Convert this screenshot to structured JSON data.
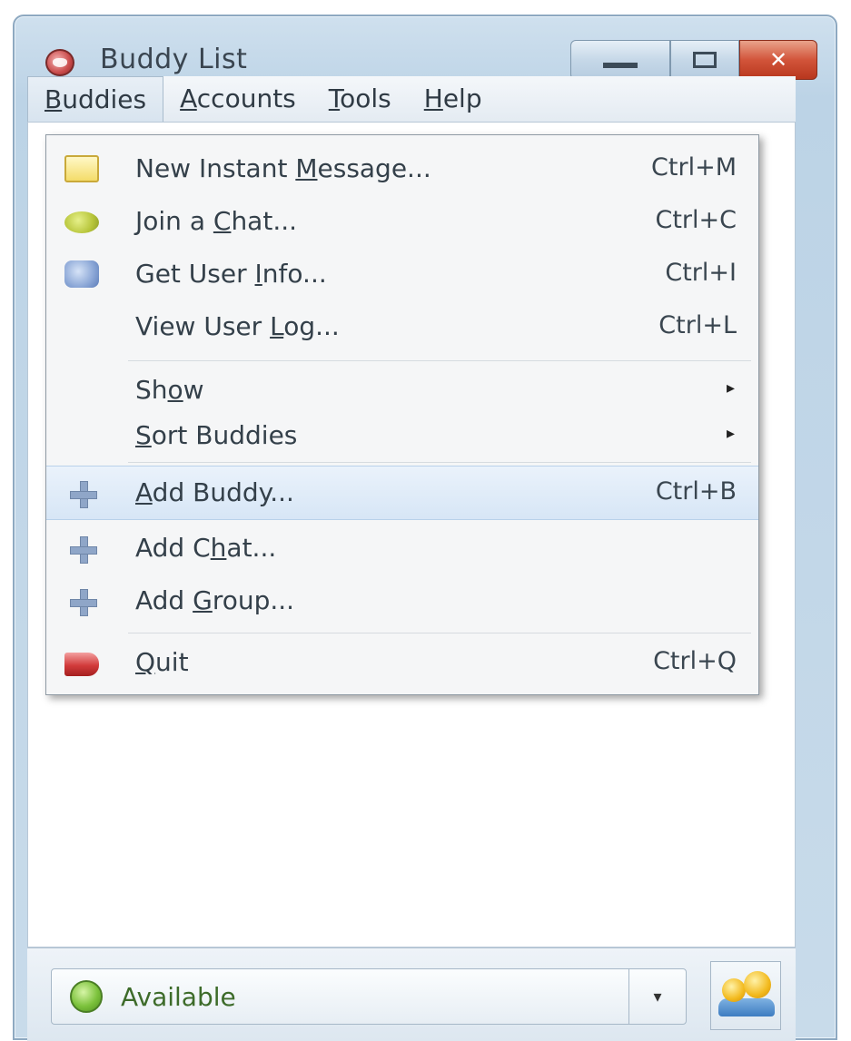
{
  "window": {
    "title": "Buddy List",
    "close_glyph": "✕"
  },
  "menubar": {
    "items": [
      {
        "mnemonic": "B",
        "rest": "uddies"
      },
      {
        "mnemonic": "A",
        "rest": "ccounts"
      },
      {
        "mnemonic": "T",
        "rest": "ools"
      },
      {
        "mnemonic": "H",
        "rest": "elp"
      }
    ]
  },
  "menu": {
    "items": [
      {
        "pre": "New Instant ",
        "mn": "M",
        "post": "essage...",
        "shortcut": "Ctrl+M",
        "icon": "new-message-icon"
      },
      {
        "pre": "Join a ",
        "mn": "C",
        "post": "hat...",
        "shortcut": "Ctrl+C",
        "icon": "join-chat-icon"
      },
      {
        "pre": "Get User ",
        "mn": "I",
        "post": "nfo...",
        "shortcut": "Ctrl+I",
        "icon": "user-info-icon"
      },
      {
        "pre": "View User ",
        "mn": "L",
        "post": "og...",
        "shortcut": "Ctrl+L",
        "icon": ""
      },
      {
        "pre": "Sh",
        "mn": "o",
        "post": "w",
        "submenu_glyph": "▸",
        "icon": ""
      },
      {
        "pre": "",
        "mn": "S",
        "post": "ort Buddies",
        "submenu_glyph": "▸",
        "icon": ""
      },
      {
        "pre": "",
        "mn": "A",
        "post": "dd Buddy...",
        "shortcut": "Ctrl+B",
        "icon": "add-icon"
      },
      {
        "pre": "Add C",
        "mn": "h",
        "post": "at...",
        "shortcut": "",
        "icon": "add-icon"
      },
      {
        "pre": "Add ",
        "mn": "G",
        "post": "roup...",
        "shortcut": "",
        "icon": "add-icon"
      },
      {
        "pre": "",
        "mn": "Q",
        "post": "uit",
        "shortcut": "Ctrl+Q",
        "icon": "quit-icon"
      }
    ]
  },
  "status": {
    "label": "Available",
    "dropdown_glyph": "▾"
  }
}
